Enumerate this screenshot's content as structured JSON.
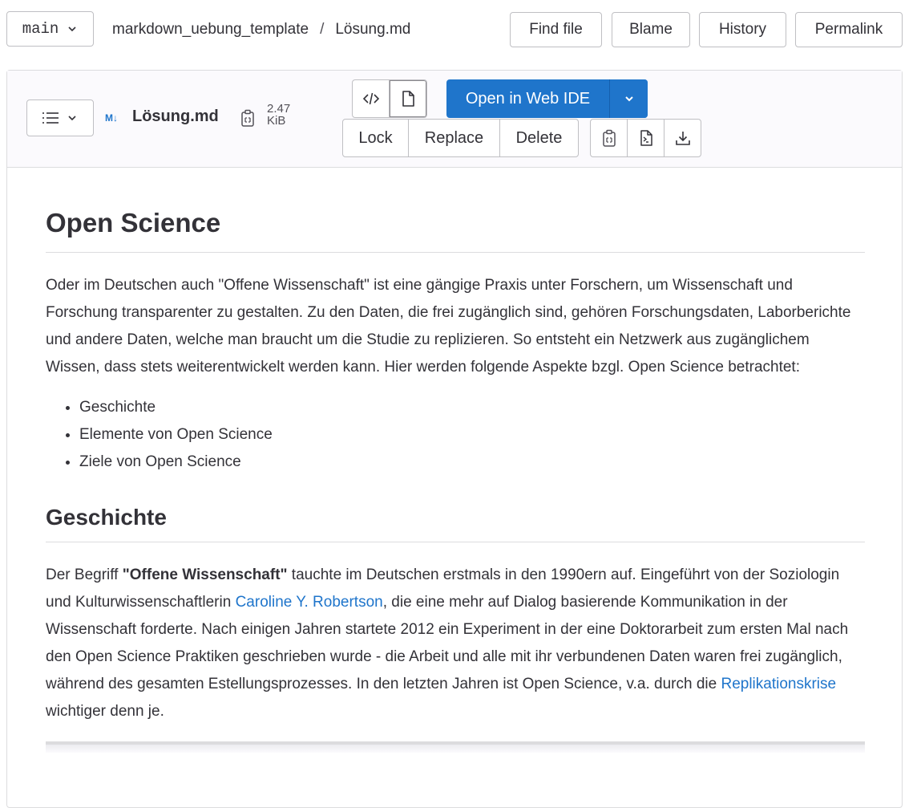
{
  "topbar": {
    "branch": "main",
    "project": "markdown_uebung_template",
    "separator": "/",
    "file": "Lösung.md",
    "buttons": {
      "find": "Find file",
      "blame": "Blame",
      "history": "History",
      "permalink": "Permalink"
    }
  },
  "file_header": {
    "md_badge": "M↓",
    "filename": "Lösung.md",
    "size_value": "2.47",
    "size_unit": "KiB",
    "open_ide": "Open in Web IDE",
    "actions": {
      "lock": "Lock",
      "replace": "Replace",
      "delete": "Delete"
    }
  },
  "content": {
    "h1": "Open Science",
    "intro": "Oder im Deutschen auch \"Offene Wissenschaft\" ist eine gängige Praxis unter Forschern, um Wissenschaft und Forschung transparenter zu gestalten. Zu den Daten, die frei zugänglich sind, gehören Forschungsdaten, Laborberichte und andere Daten, welche man braucht um die Studie zu replizieren. So entsteht ein Netzwerk aus zugänglichem Wissen, dass stets weiterentwickelt werden kann. Hier werden folgende Aspekte bzgl. Open Science betrachtet:",
    "list": [
      "Geschichte",
      "Elemente von Open Science",
      "Ziele von Open Science"
    ],
    "h2": "Geschichte",
    "history": {
      "t1": "Der Begriff ",
      "bold": "\"Offene Wissenschaft\"",
      "t2": " tauchte im Deutschen erstmals in den 1990ern auf. Eingeführt von der Soziologin und Kulturwissenschaftlerin ",
      "link1": "Caroline Y. Robertson",
      "t3": ", die eine mehr auf Dialog basierende Kommunikation in der Wissenschaft forderte. Nach einigen Jahren startete 2012 ein Experiment in der eine Doktorarbeit zum ersten Mal nach den Open Science Praktiken geschrieben wurde - die Arbeit und alle mit ihr verbundenen Daten waren frei zugänglich, während des gesamten Estellungsprozesses. In den letzten Jahren ist Open Science, v.a. durch die ",
      "link2": "Replikationskrise",
      "t4": " wichtiger denn je."
    }
  },
  "colors": {
    "accent": "#1f75cb",
    "text": "#333238",
    "border": "#dcdcde",
    "header_bg": "#fbfafd"
  }
}
